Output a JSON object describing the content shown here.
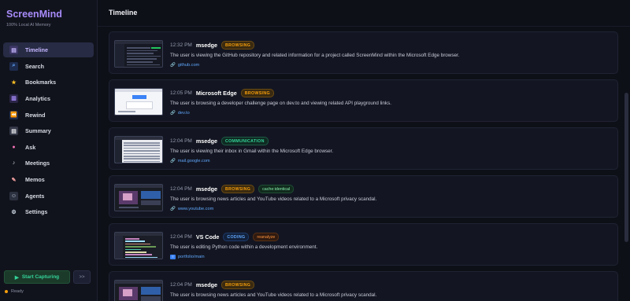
{
  "sidebar": {
    "brand": "ScreenMind",
    "tagline": "100% Local AI Memory",
    "items": [
      {
        "label": "Timeline",
        "icon": "timeline-icon",
        "glyph": "▤",
        "color": "#c4b5fd",
        "bg": "#3b3563"
      },
      {
        "label": "Search",
        "icon": "search-icon",
        "glyph": "⌕",
        "color": "#60a5fa",
        "bg": "#1d2c4d"
      },
      {
        "label": "Bookmarks",
        "icon": "star-icon",
        "glyph": "★",
        "color": "#fbbf24",
        "bg": "transparent"
      },
      {
        "label": "Analytics",
        "icon": "bar-chart-icon",
        "glyph": "▥",
        "color": "#a78bfa",
        "bg": "#2a2547"
      },
      {
        "label": "Rewind",
        "icon": "rewind-icon",
        "glyph": "⏪",
        "color": "#93c5fd",
        "bg": "#1d2c4d"
      },
      {
        "label": "Summary",
        "icon": "document-icon",
        "glyph": "▤",
        "color": "#e5e7eb",
        "bg": "#343847"
      },
      {
        "label": "Ask",
        "icon": "brain-icon",
        "glyph": "●",
        "color": "#f472b6",
        "bg": "transparent"
      },
      {
        "label": "Meetings",
        "icon": "microphone-icon",
        "glyph": "♪",
        "color": "#d1d5db",
        "bg": "transparent"
      },
      {
        "label": "Memos",
        "icon": "pencil-icon",
        "glyph": "✎",
        "color": "#fca5a5",
        "bg": "transparent"
      },
      {
        "label": "Agents",
        "icon": "robot-icon",
        "glyph": "☺",
        "color": "#cbd5e1",
        "bg": "#2c3140"
      },
      {
        "label": "Settings",
        "icon": "gear-icon",
        "glyph": "⚙",
        "color": "#cbd5e1",
        "bg": "transparent"
      }
    ],
    "active_index": 0,
    "capture_label": "Start Capturing",
    "collapse_label": ">>",
    "status_text": "Ready"
  },
  "main": {
    "title": "Timeline",
    "entries": [
      {
        "time": "12:32 PM",
        "app": "msedge",
        "badges": [
          {
            "text": "BROWSING",
            "kind": "browsing"
          }
        ],
        "summary": "The user is viewing the GitHub repository and related information for a project called ScreenMind within the Microsoft Edge browser.",
        "link": "github.com",
        "link_kind": "url",
        "thumb": "dark"
      },
      {
        "time": "12:05 PM",
        "app": "Microsoft Edge",
        "badges": [
          {
            "text": "BROWSING",
            "kind": "browsing"
          }
        ],
        "summary": "The user is browsing a developer challenge page on dev.to and viewing related API playground links.",
        "link": "dev.to",
        "link_kind": "url",
        "thumb": "light"
      },
      {
        "time": "12:04 PM",
        "app": "msedge",
        "badges": [
          {
            "text": "COMMUNICATION",
            "kind": "communication"
          }
        ],
        "summary": "The user is viewing their inbox in Gmail within the Microsoft Edge browser.",
        "link": "mail.google.com",
        "link_kind": "url",
        "thumb": "mail"
      },
      {
        "time": "12:04 PM",
        "app": "msedge",
        "badges": [
          {
            "text": "BROWSING",
            "kind": "browsing"
          },
          {
            "text": "cache:identical",
            "kind": "cache"
          }
        ],
        "summary": "The user is browsing news articles and YouTube videos related to a Microsoft privacy scandal.",
        "link": "www.youtube.com",
        "link_kind": "url",
        "thumb": "video"
      },
      {
        "time": "12:04 PM",
        "app": "VS Code",
        "badges": [
          {
            "text": "CODING",
            "kind": "coding"
          },
          {
            "text": "reanalyze",
            "kind": "reanalyze"
          }
        ],
        "summary": "The user is editing Python code within a development environment.",
        "link": "portfolio/main",
        "link_kind": "branch",
        "thumb": "code"
      },
      {
        "time": "12:04 PM",
        "app": "msedge",
        "badges": [
          {
            "text": "BROWSING",
            "kind": "browsing"
          }
        ],
        "summary": "The user is browsing news articles and YouTube videos related to a Microsoft privacy scandal.",
        "link": "",
        "link_kind": "url",
        "thumb": "video"
      }
    ]
  },
  "colors": {
    "accent": "#a78bfa",
    "browsing": "#f59e0b",
    "communication": "#34d399",
    "coding": "#60a5fa",
    "link": "#60a5fa",
    "capture": "#34d399"
  }
}
